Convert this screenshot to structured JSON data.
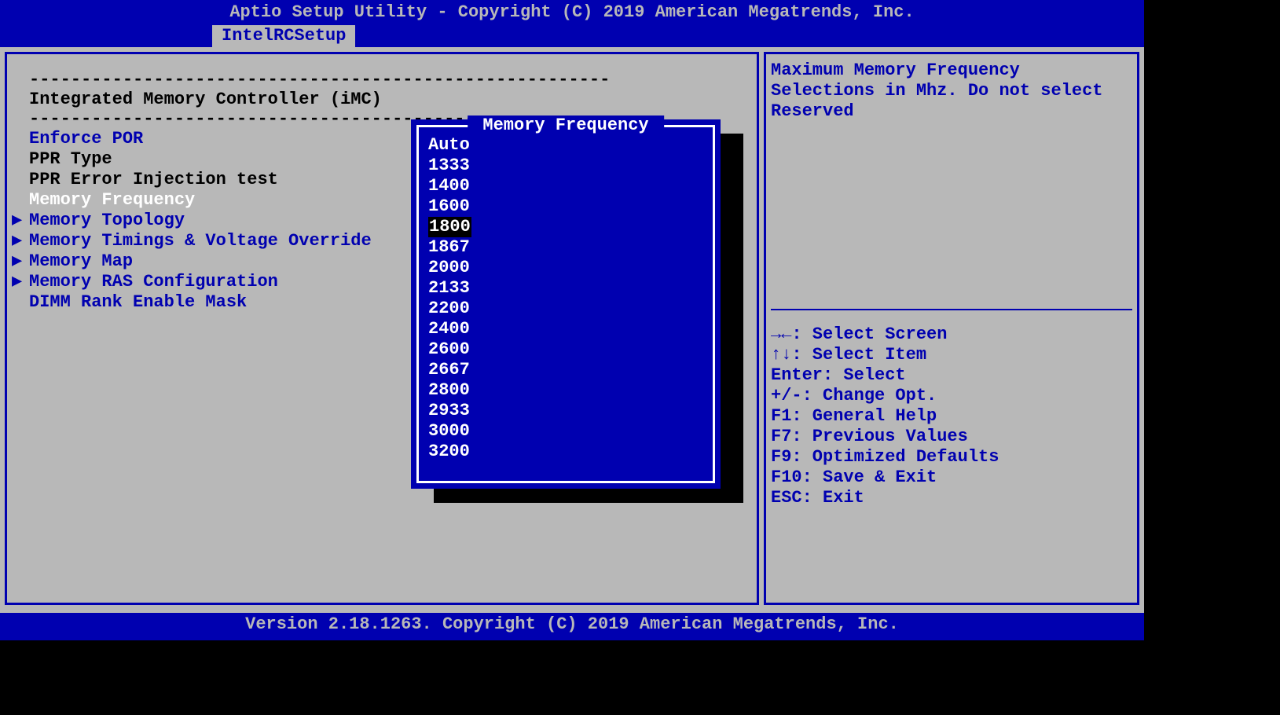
{
  "title": "Aptio Setup Utility - Copyright (C) 2019 American Megatrends, Inc.",
  "tab": "IntelRCSetup",
  "section": {
    "dashes": "--------------------------------------------------------",
    "header": "Integrated Memory Controller (iMC)"
  },
  "menu": [
    {
      "label": "Enforce POR",
      "type": "opt",
      "cls": ""
    },
    {
      "label": "PPR Type",
      "type": "opt",
      "cls": "black"
    },
    {
      "label": "PPR Error Injection test",
      "type": "opt",
      "cls": "black"
    },
    {
      "label": "Memory Frequency",
      "type": "opt",
      "cls": "selected"
    },
    {
      "label": "Memory Topology",
      "type": "sub",
      "cls": ""
    },
    {
      "label": "Memory Timings & Voltage Override",
      "type": "sub",
      "cls": ""
    },
    {
      "label": "Memory Map",
      "type": "sub",
      "cls": ""
    },
    {
      "label": "Memory RAS Configuration",
      "type": "sub",
      "cls": ""
    },
    {
      "label": "DIMM Rank Enable Mask",
      "type": "opt",
      "cls": ""
    }
  ],
  "popup": {
    "title": " Memory Frequency ",
    "options": [
      "Auto",
      "1333",
      "1400",
      "1600",
      "1800",
      "1867",
      "2000",
      "2133",
      "2200",
      "2400",
      "2600",
      "2667",
      "2800",
      "2933",
      "3000",
      "3200"
    ],
    "selected": "1800"
  },
  "help": {
    "text": "Maximum Memory Frequency Selections in Mhz. Do not select Reserved",
    "keys": [
      "→←: Select Screen",
      "↑↓: Select Item",
      "Enter: Select",
      "+/-: Change Opt.",
      "F1: General Help",
      "F7: Previous Values",
      "F9: Optimized Defaults",
      "F10: Save & Exit",
      "ESC: Exit"
    ]
  },
  "footer": "Version 2.18.1263. Copyright (C) 2019 American Megatrends, Inc."
}
